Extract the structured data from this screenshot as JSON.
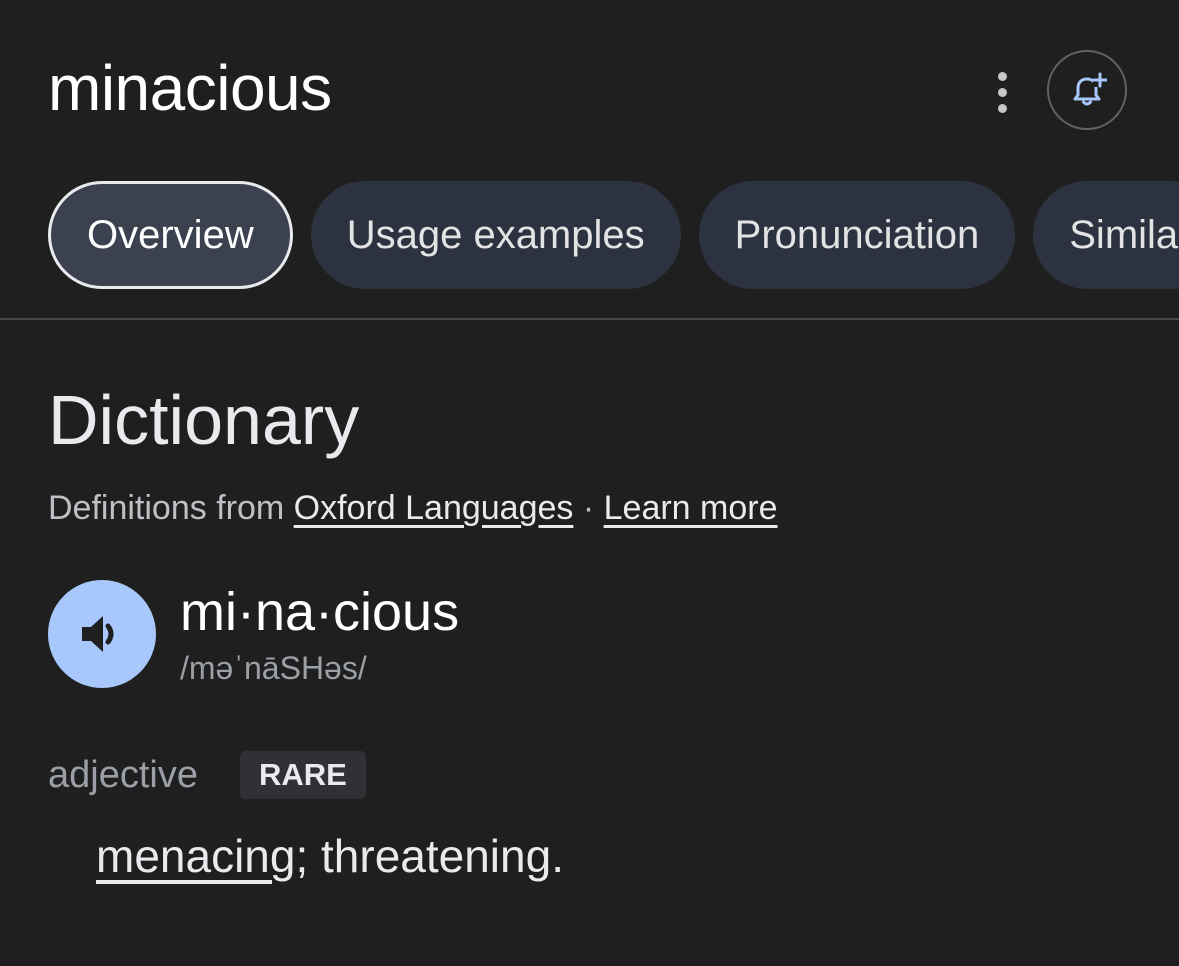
{
  "header": {
    "title": "minacious",
    "more_icon": "more-vert-icon",
    "alert_icon": "bell-plus-icon"
  },
  "tabs": [
    {
      "label": "Overview",
      "active": true
    },
    {
      "label": "Usage examples",
      "active": false
    },
    {
      "label": "Pronunciation",
      "active": false
    },
    {
      "label": "Similar",
      "active": false
    }
  ],
  "dictionary": {
    "title": "Dictionary",
    "source_prefix": "Definitions from ",
    "source_link": "Oxford Languages",
    "separator": " · ",
    "learn_more": "Learn more",
    "headword": "mi·na·cious",
    "phonetic": "/məˈnāSHəs/",
    "speaker_icon": "volume-icon",
    "part_of_speech": "adjective",
    "badge": "RARE",
    "definition_link": "menacing",
    "definition_rest": "; threatening."
  },
  "colors": {
    "background": "#1f1f1f",
    "chip": "#2d3240",
    "accent": "#a8c7fa"
  }
}
